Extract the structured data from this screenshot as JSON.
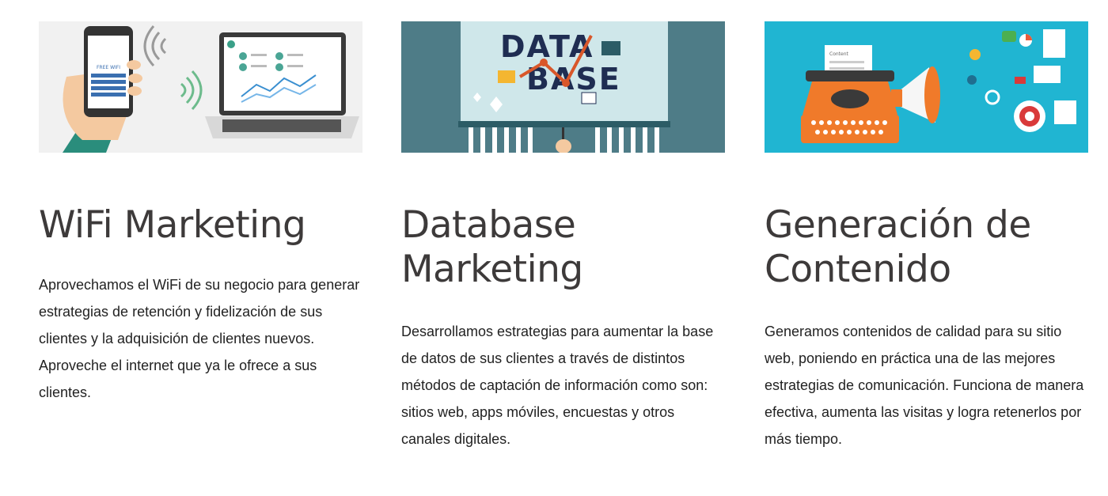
{
  "cards": [
    {
      "title": "WiFi Marketing",
      "description": "Aprovechamos el WiFi de su negocio para generar estrategias de retención y fidelización de sus clientes y la adquisición de clientes nuevos. Aproveche el internet que ya le ofrece a sus clientes.",
      "image_text": "FREE WIFI",
      "image_bg": "#f1f1f1"
    },
    {
      "title": "Database Marketing",
      "description": "Desarrollamos estrategias para aumentar la base de datos de sus clientes a través de distintos métodos de captación de información como son: sitios web, apps móviles, encuestas y otros canales digitales.",
      "image_text_1": "DATA",
      "image_text_2": "BASE",
      "image_bg": "#4e7c87"
    },
    {
      "title": "Generación de Contenido",
      "description": "Generamos contenidos de calidad para su sitio web, poniendo en práctica una de las mejores estrategias de comunicación. Funciona de manera efectiva, aumenta las visitas y logra retenerlos por más tiempo.",
      "image_text": "Content",
      "image_bg": "#20b5d2"
    }
  ]
}
